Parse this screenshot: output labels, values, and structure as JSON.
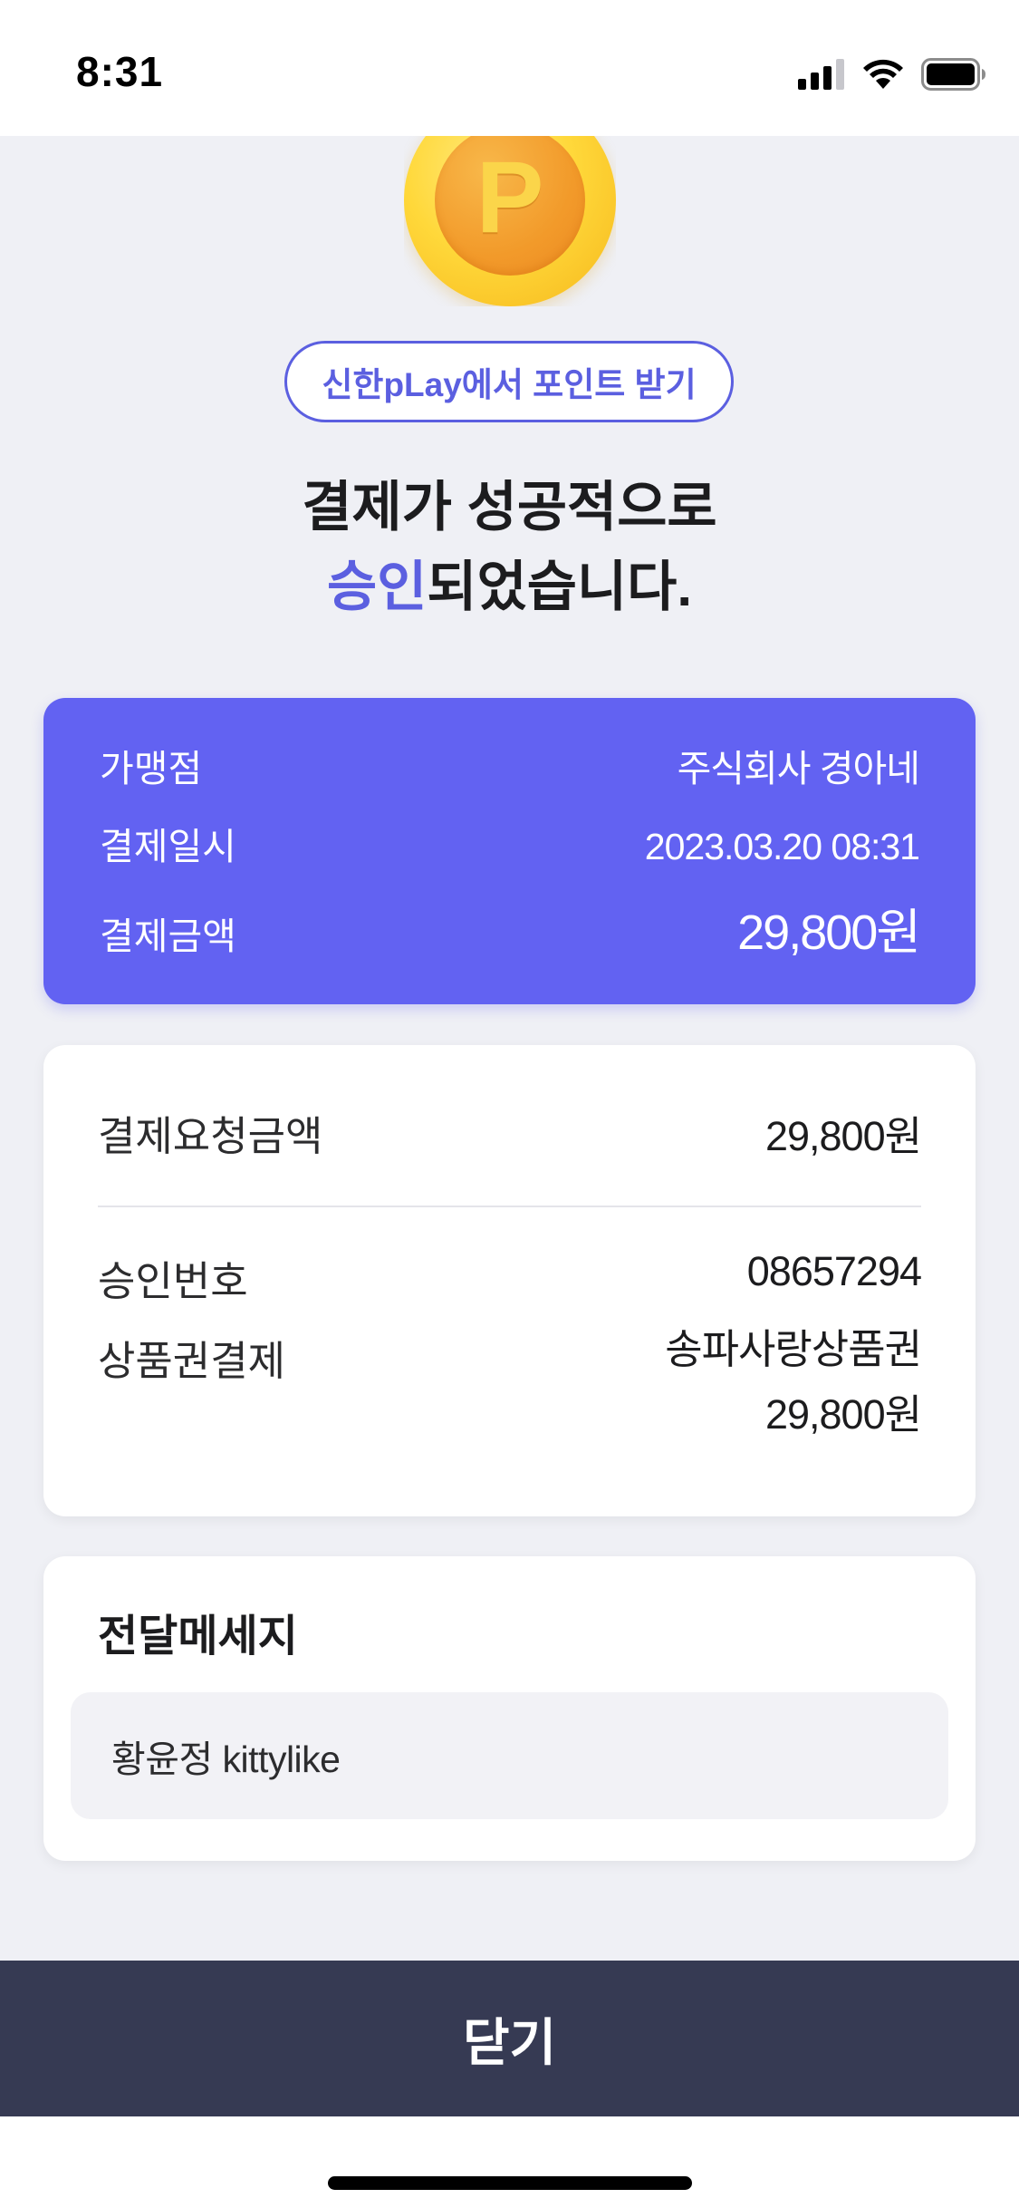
{
  "status_bar": {
    "time": "8:31"
  },
  "coin": {
    "letter": "P"
  },
  "points_button": {
    "label": "신한pLay에서 포인트 받기"
  },
  "title": {
    "line1": "결제가 성공적으로",
    "accent": "승인",
    "line2_rest": "되었습니다."
  },
  "summary": {
    "merchant_label": "가맹점",
    "merchant_value": "주식회사 경아네",
    "datetime_label": "결제일시",
    "datetime_value": "2023.03.20 08:31",
    "amount_label": "결제금액",
    "amount_value": "29,800원"
  },
  "details": {
    "requested_label": "결제요청금액",
    "requested_value": "29,800원",
    "approval_label": "승인번호",
    "approval_value": "08657294",
    "voucher_label": "상품권결제",
    "voucher_name": "송파사랑상품권",
    "voucher_amount": "29,800원"
  },
  "message": {
    "title": "전달메세지",
    "text": "황윤정 kittylike"
  },
  "close_button": {
    "label": "닫기"
  },
  "colors": {
    "accent": "#6262f2",
    "button": "#363a53",
    "background": "#eff0f5"
  }
}
